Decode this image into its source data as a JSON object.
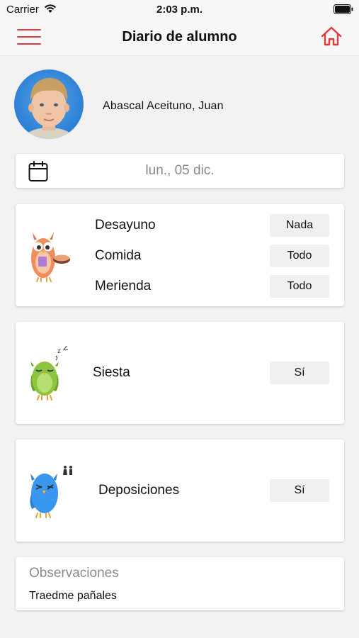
{
  "status_bar": {
    "carrier": "Carrier",
    "time": "2:03 p.m."
  },
  "header": {
    "title": "Diario de alumno",
    "menu_icon": "hamburger-menu-icon",
    "home_icon": "home-icon",
    "accent_color": "#e0393e"
  },
  "student": {
    "name": "Abascal Aceituno, Juan"
  },
  "date": {
    "icon": "calendar-icon",
    "value": "lun., 05 dic."
  },
  "meals": {
    "icon": "owl-eating-icon",
    "items": [
      {
        "label": "Desayuno",
        "value": "Nada"
      },
      {
        "label": "Comida",
        "value": "Todo"
      },
      {
        "label": "Merienda",
        "value": "Todo"
      }
    ]
  },
  "nap": {
    "icon": "owl-sleeping-icon",
    "label": "Siesta",
    "value": "Sí"
  },
  "bowel": {
    "icon": "owl-toilet-icon",
    "label": "Deposiciones",
    "value": "Sí"
  },
  "observations": {
    "label": "Observaciones",
    "text": "Traedme pañales"
  }
}
